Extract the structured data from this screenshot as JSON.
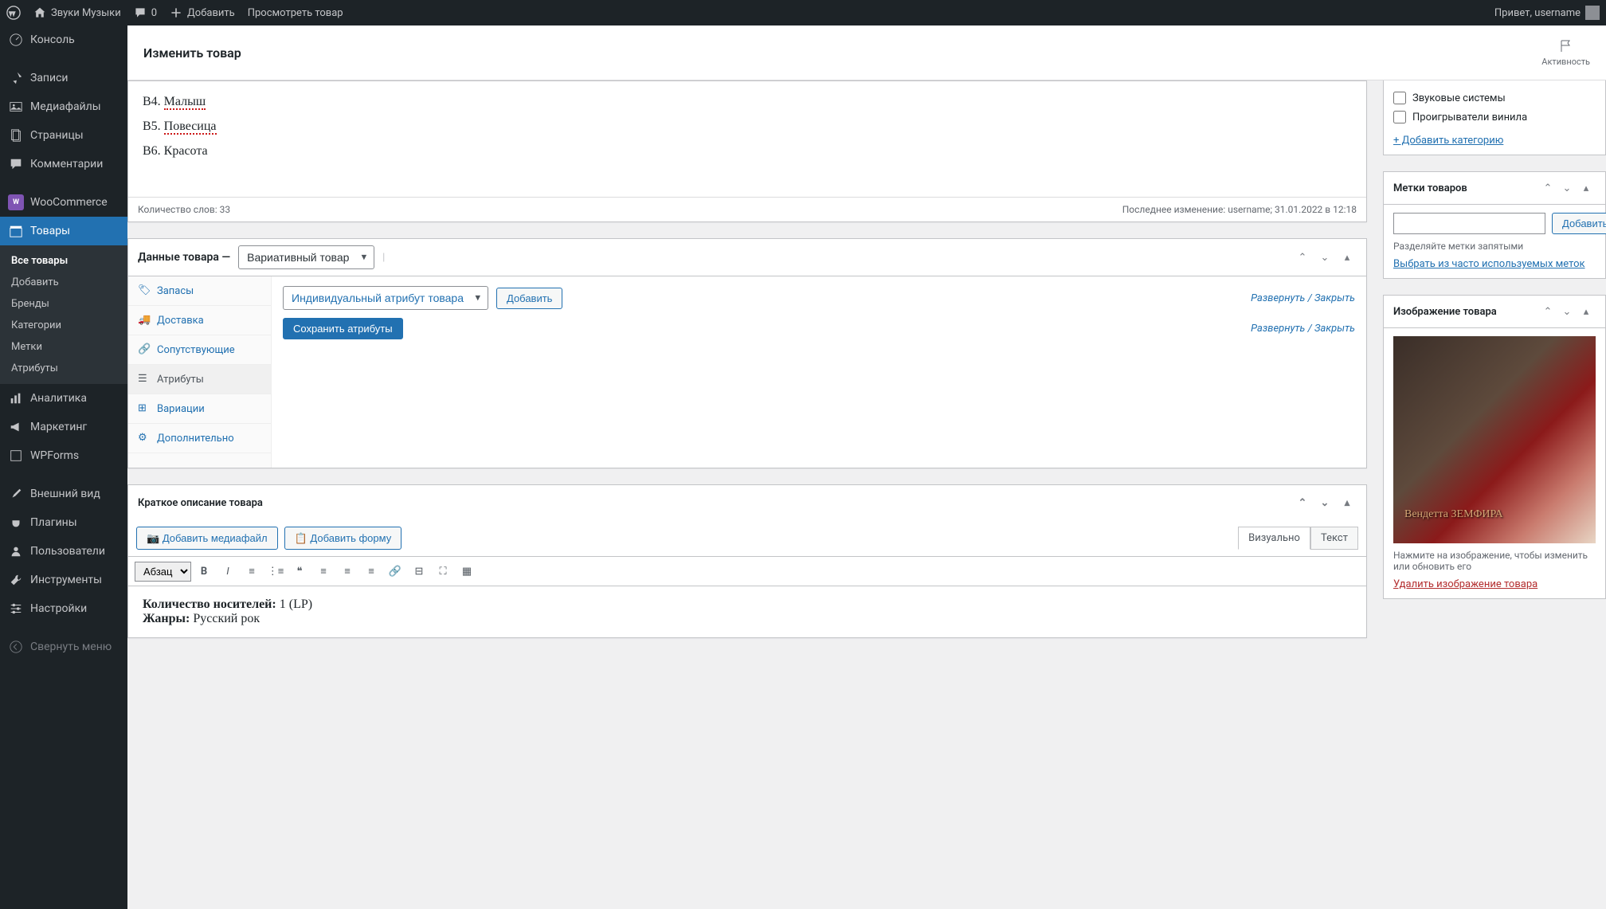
{
  "adminbar": {
    "site_name": "Звуки Музыки",
    "comments_count": "0",
    "add_new": "Добавить",
    "view_product": "Просмотреть товар",
    "greeting": "Привет, username"
  },
  "sidebar": {
    "console": "Консоль",
    "posts": "Записи",
    "media": "Медиафайлы",
    "pages": "Страницы",
    "comments": "Комментарии",
    "woocommerce": "WooCommerce",
    "products": "Товары",
    "products_sub": {
      "all": "Все товары",
      "add": "Добавить",
      "brands": "Бренды",
      "categories": "Категории",
      "tags": "Метки",
      "attributes": "Атрибуты"
    },
    "analytics": "Аналитика",
    "marketing": "Маркетинг",
    "wpforms": "WPForms",
    "appearance": "Внешний вид",
    "plugins": "Плагины",
    "users": "Пользователи",
    "tools": "Инструменты",
    "settings": "Настройки",
    "collapse": "Свернуть меню"
  },
  "page": {
    "title": "Изменить товар",
    "activity": "Активность"
  },
  "editor": {
    "lines": [
      {
        "prefix": "B4. ",
        "word": "Малыш"
      },
      {
        "prefix": "B5. ",
        "word": "Повесица"
      },
      {
        "prefix": "B6. ",
        "word": "Красота"
      }
    ],
    "word_count_label": "Количество слов: 33",
    "last_edit": "Последнее изменение: username; 31.01.2022 в 12:18"
  },
  "product_data": {
    "header_label": "Данные товара —",
    "type_select": "Вариативный товар",
    "tabs": {
      "inventory": "Запасы",
      "shipping": "Доставка",
      "linked": "Сопутствующие",
      "attributes": "Атрибуты",
      "variations": "Вариации",
      "advanced": "Дополнительно"
    },
    "attr_select": "Индивидуальный атрибут товара",
    "add_btn": "Добавить",
    "expand": "Развернуть",
    "close": "Закрыть",
    "sep": " / ",
    "save_attrs": "Сохранить атрибуты"
  },
  "short_desc": {
    "title": "Краткое описание товара",
    "add_media": "Добавить медиафайл",
    "add_form": "Добавить форму",
    "tab_visual": "Визуально",
    "tab_text": "Текст",
    "format_select": "Абзац",
    "body_qty_label": "Количество носителей:",
    "body_qty_val": " 1 (LP)",
    "body_genre_label": "Жанры:",
    "body_genre_val": " Русский рок"
  },
  "categories": {
    "cb1": "Звуковые системы",
    "cb2": "Проигрыватели винила",
    "add_link": "+ Добавить категорию"
  },
  "tags": {
    "title": "Метки товаров",
    "add_btn": "Добавить",
    "hint": "Разделяйте метки запятыми",
    "popular_link": "Выбрать из часто используемых меток"
  },
  "image": {
    "title": "Изображение товара",
    "hint": "Нажмите на изображение, чтобы изменить или обновить его",
    "remove_link": "Удалить изображение товара"
  }
}
